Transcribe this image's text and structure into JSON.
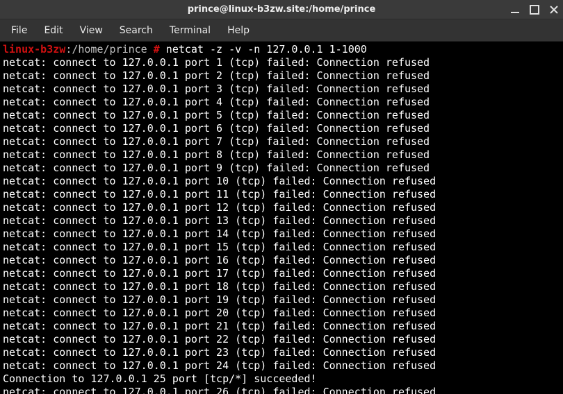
{
  "window": {
    "title": "prince@linux-b3zw.site:/home/prince"
  },
  "menu": {
    "items": [
      "File",
      "Edit",
      "View",
      "Search",
      "Terminal",
      "Help"
    ]
  },
  "prompt": {
    "host": "linux-b3zw",
    "path": ":/home/prince",
    "symbol": " #",
    "command": " netcat -z -v -n 127.0.0.1 1-1000"
  },
  "output": {
    "refused_prefix": "netcat: connect to 127.0.0.1 port ",
    "refused_suffix": " (tcp) failed: Connection refused",
    "success_line": "Connection to 127.0.0.1 25 port [tcp/*] succeeded!",
    "ports_before_success": [
      1,
      2,
      3,
      4,
      5,
      6,
      7,
      8,
      9,
      10,
      11,
      12,
      13,
      14,
      15,
      16,
      17,
      18,
      19,
      20,
      21,
      22,
      23,
      24
    ],
    "ports_after_success": [
      26
    ]
  }
}
